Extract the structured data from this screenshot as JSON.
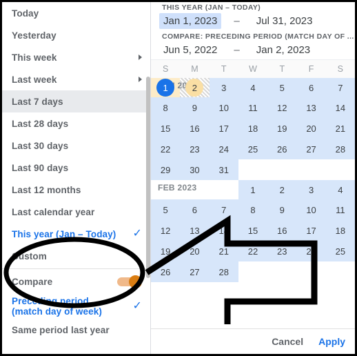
{
  "menu": {
    "items": [
      {
        "label": "Today",
        "type": "plain"
      },
      {
        "label": "Yesterday",
        "type": "plain"
      },
      {
        "label": "This week",
        "type": "submenu"
      },
      {
        "label": "Last week",
        "type": "submenu"
      },
      {
        "label": "Last 7 days",
        "type": "highlighted"
      },
      {
        "label": "Last 28 days",
        "type": "plain"
      },
      {
        "label": "Last 30 days",
        "type": "plain"
      },
      {
        "label": "Last 90 days",
        "type": "plain"
      },
      {
        "label": "Last 12 months",
        "type": "plain"
      },
      {
        "label": "Last calendar year",
        "type": "plain"
      },
      {
        "label": "This year (Jan – Today)",
        "type": "selected"
      },
      {
        "label": "Custom",
        "type": "plain"
      }
    ],
    "compare": {
      "label": "Compare",
      "toggle_on": true,
      "toggle_color": "#da7d12",
      "track_color": "#f0b98a"
    },
    "compare_options": [
      {
        "label_line1": "Preceding period",
        "label_line2": "(match day of week)",
        "selected": true
      },
      {
        "label_line1": "Same period last year",
        "label_line2": "",
        "selected": false
      }
    ],
    "check_glyph": "✓",
    "accent_color": "#1a73e8"
  },
  "range": {
    "primary_label": "THIS YEAR (JAN – TODAY)",
    "primary_start": "Jan 1, 2023",
    "primary_end": "Jul 31, 2023",
    "dash": "–",
    "compare_label": "COMPARE: PRECEDING PERIOD (MATCH DAY OF ...",
    "compare_start": "Jun 5, 2022",
    "compare_end": "Jan 2, 2023"
  },
  "calendar": {
    "weekdays": [
      "S",
      "M",
      "T",
      "W",
      "T",
      "F",
      "S"
    ],
    "months": [
      {
        "label": "JAN 2023",
        "weeks": [
          [
            {
              "d": "1",
              "state": "start"
            },
            {
              "d": "2",
              "state": "cmpstart"
            },
            {
              "d": "3",
              "state": "inrange"
            },
            {
              "d": "4",
              "state": "inrange"
            },
            {
              "d": "5",
              "state": "inrange"
            },
            {
              "d": "6",
              "state": "inrange"
            },
            {
              "d": "7",
              "state": "inrange"
            }
          ],
          [
            {
              "d": "8",
              "state": "inrange"
            },
            {
              "d": "9",
              "state": "inrange"
            },
            {
              "d": "10",
              "state": "inrange"
            },
            {
              "d": "11",
              "state": "inrange"
            },
            {
              "d": "12",
              "state": "inrange"
            },
            {
              "d": "13",
              "state": "inrange"
            },
            {
              "d": "14",
              "state": "inrange"
            }
          ],
          [
            {
              "d": "15",
              "state": "inrange"
            },
            {
              "d": "16",
              "state": "inrange"
            },
            {
              "d": "17",
              "state": "inrange"
            },
            {
              "d": "18",
              "state": "inrange"
            },
            {
              "d": "19",
              "state": "inrange"
            },
            {
              "d": "20",
              "state": "inrange"
            },
            {
              "d": "21",
              "state": "inrange"
            }
          ],
          [
            {
              "d": "22",
              "state": "inrange"
            },
            {
              "d": "23",
              "state": "inrange"
            },
            {
              "d": "24",
              "state": "inrange"
            },
            {
              "d": "25",
              "state": "inrange"
            },
            {
              "d": "26",
              "state": "inrange"
            },
            {
              "d": "27",
              "state": "inrange"
            },
            {
              "d": "28",
              "state": "inrange"
            }
          ],
          [
            {
              "d": "29",
              "state": "inrange"
            },
            {
              "d": "30",
              "state": "inrange"
            },
            {
              "d": "31",
              "state": "inrange"
            },
            {
              "d": "",
              "state": "empty"
            },
            {
              "d": "",
              "state": "empty"
            },
            {
              "d": "",
              "state": "empty"
            },
            {
              "d": "",
              "state": "empty"
            }
          ]
        ]
      },
      {
        "label": "FEB 2023",
        "weeks": [
          [
            {
              "d": "",
              "state": "empty"
            },
            {
              "d": "",
              "state": "empty"
            },
            {
              "d": "",
              "state": "empty"
            },
            {
              "d": "1",
              "state": "inrange"
            },
            {
              "d": "2",
              "state": "inrange"
            },
            {
              "d": "3",
              "state": "inrange"
            },
            {
              "d": "4",
              "state": "inrange"
            }
          ],
          [
            {
              "d": "5",
              "state": "inrange"
            },
            {
              "d": "6",
              "state": "inrange"
            },
            {
              "d": "7",
              "state": "inrange"
            },
            {
              "d": "8",
              "state": "inrange"
            },
            {
              "d": "9",
              "state": "inrange"
            },
            {
              "d": "10",
              "state": "inrange"
            },
            {
              "d": "11",
              "state": "inrange"
            }
          ],
          [
            {
              "d": "12",
              "state": "inrange"
            },
            {
              "d": "13",
              "state": "inrange"
            },
            {
              "d": "14",
              "state": "inrange"
            },
            {
              "d": "15",
              "state": "inrange"
            },
            {
              "d": "16",
              "state": "inrange"
            },
            {
              "d": "17",
              "state": "inrange"
            },
            {
              "d": "18",
              "state": "inrange"
            }
          ],
          [
            {
              "d": "19",
              "state": "inrange"
            },
            {
              "d": "20",
              "state": "inrange"
            },
            {
              "d": "21",
              "state": "inrange"
            },
            {
              "d": "22",
              "state": "inrange"
            },
            {
              "d": "23",
              "state": "inrange"
            },
            {
              "d": "24",
              "state": "inrange"
            },
            {
              "d": "25",
              "state": "inrange"
            }
          ],
          [
            {
              "d": "26",
              "state": "inrange"
            },
            {
              "d": "27",
              "state": "inrange"
            },
            {
              "d": "28",
              "state": "inrange"
            },
            {
              "d": "",
              "state": "empty"
            },
            {
              "d": "",
              "state": "empty"
            },
            {
              "d": "",
              "state": "empty"
            },
            {
              "d": "",
              "state": "empty"
            }
          ]
        ]
      }
    ]
  },
  "footer": {
    "cancel": "Cancel",
    "apply": "Apply"
  },
  "annotations": {
    "ellipse_target": "compare-toggle",
    "arrow_direction": "left",
    "ink_color": "#000000"
  }
}
